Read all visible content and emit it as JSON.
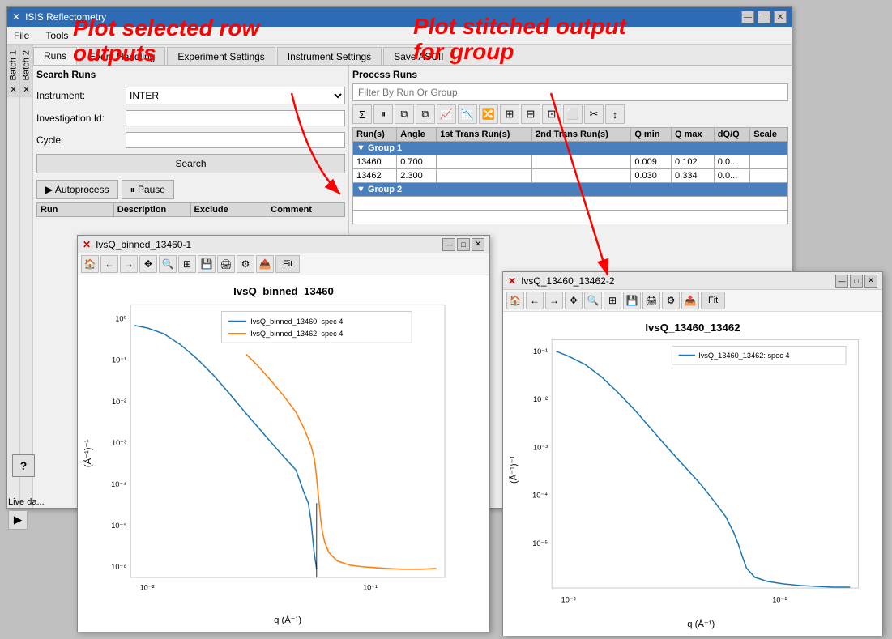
{
  "app": {
    "title": "ISIS Reflectometry",
    "icon": "X"
  },
  "menu": {
    "items": [
      "File",
      "Tools"
    ]
  },
  "batch_tabs": [
    {
      "id": "batch1",
      "label": "Batch 1",
      "close": "×"
    },
    {
      "id": "batch2",
      "label": "Batch 2",
      "close": "×"
    }
  ],
  "tabs": [
    {
      "id": "runs",
      "label": "Runs",
      "active": true
    },
    {
      "id": "event",
      "label": "Event Handling"
    },
    {
      "id": "experiment",
      "label": "Experiment Settings"
    },
    {
      "id": "instrument",
      "label": "Instrument Settings"
    },
    {
      "id": "save",
      "label": "Save ASCII"
    }
  ],
  "search_runs": {
    "title": "Search Runs",
    "instrument_label": "Instrument:",
    "instrument_value": "INTER",
    "investigation_label": "Investigation Id:",
    "investigation_value": "",
    "cycle_label": "Cycle:",
    "cycle_value": "",
    "search_btn": "Search",
    "autoprocess_btn": "▶ Autoprocess",
    "pause_btn": "⏸ Pause"
  },
  "columns": {
    "run": "Run",
    "description": "Description",
    "exclude": "Exclude",
    "comment": "Comment"
  },
  "process_runs": {
    "title": "Process Runs",
    "filter_placeholder": "Filter By Run Or Group",
    "columns": [
      "Run(s)",
      "Angle",
      "1st Trans Run(s)",
      "2nd Trans Run(s)",
      "Q min",
      "Q max",
      "dQ/Q",
      "Scale"
    ],
    "toolbar_icons": [
      "Σ",
      "⏸",
      "⧉",
      "⧉",
      "📈",
      "📉",
      "🔀",
      "⊞",
      "⊟",
      "⊡",
      "⬜",
      "✂",
      "↕"
    ]
  },
  "groups": [
    {
      "name": "Group 1",
      "rows": [
        {
          "run": "13460",
          "angle": "0.700",
          "trans1": "",
          "trans2": "",
          "qmin": "0.009",
          "qmax": "0.102",
          "dqdq": "0.0..."
        },
        {
          "run": "13462",
          "angle": "2.300",
          "trans1": "",
          "trans2": "",
          "qmin": "0.030",
          "qmax": "0.334",
          "dqdq": "0.0..."
        }
      ]
    },
    {
      "name": "Group 2",
      "rows": []
    }
  ],
  "annotations": {
    "plot_selected": "Plot selected row\noutputs",
    "plot_stitched": "Plot stitched output\nfor group"
  },
  "plot1": {
    "title": "IvsQ_binned_13460-1",
    "icon": "X",
    "chart_title": "IvsQ_binned_13460",
    "legend": [
      {
        "label": "IvsQ_binned_13460: spec 4",
        "color": "#1f77b4"
      },
      {
        "label": "IvsQ_binned_13462: spec 4",
        "color": "#ff7f0e"
      }
    ],
    "xaxis": "q (Å⁻¹)",
    "yaxis": "(Å⁻¹)⁻¹"
  },
  "plot2": {
    "title": "IvsQ_13460_13462-2",
    "icon": "X",
    "chart_title": "IvsQ_13460_13462",
    "legend": [
      {
        "label": "IvsQ_13460_13462: spec 4",
        "color": "#1f77b4"
      }
    ],
    "xaxis": "q (Å⁻¹)",
    "yaxis": "(Å⁻¹)⁻¹"
  },
  "live": {
    "label": "Live da...",
    "play_btn": "▶"
  },
  "help": {
    "label": "?"
  }
}
